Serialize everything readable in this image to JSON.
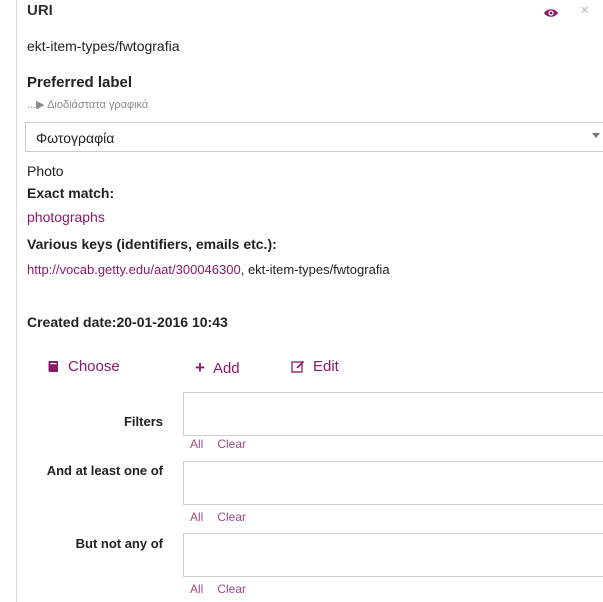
{
  "uri": {
    "title": "URI",
    "value": "ekt-item-types/fwtografia"
  },
  "header_icons": [
    "eye-icon",
    "close-icon"
  ],
  "preferred_label": {
    "heading": "Preferred label",
    "breadcrumb": "...▶ Διοδιάστατα γραφικά",
    "select_value": "Φωτογραφία",
    "english": "Photo"
  },
  "exact_match": {
    "heading": "Exact match:",
    "value": "photographs"
  },
  "various_keys": {
    "heading": "Various keys (identifiers, emails etc.):",
    "link": "http://vocab.getty.edu/aat/300046300",
    "rest": ", ekt-item-types/fwtografia"
  },
  "created": "Created date:20-01-2016 10:43",
  "actions": {
    "choose": "Choose",
    "add": "Add",
    "edit": "Edit"
  },
  "filters": [
    {
      "label": "Filters",
      "all": "All",
      "clear": "Clear"
    },
    {
      "label": "And at least one of",
      "all": "All",
      "clear": "Clear"
    },
    {
      "label": "But not any of",
      "all": "All",
      "clear": "Clear"
    }
  ],
  "colors": {
    "accent": "#8b1a6b",
    "border": "#cccccc"
  }
}
